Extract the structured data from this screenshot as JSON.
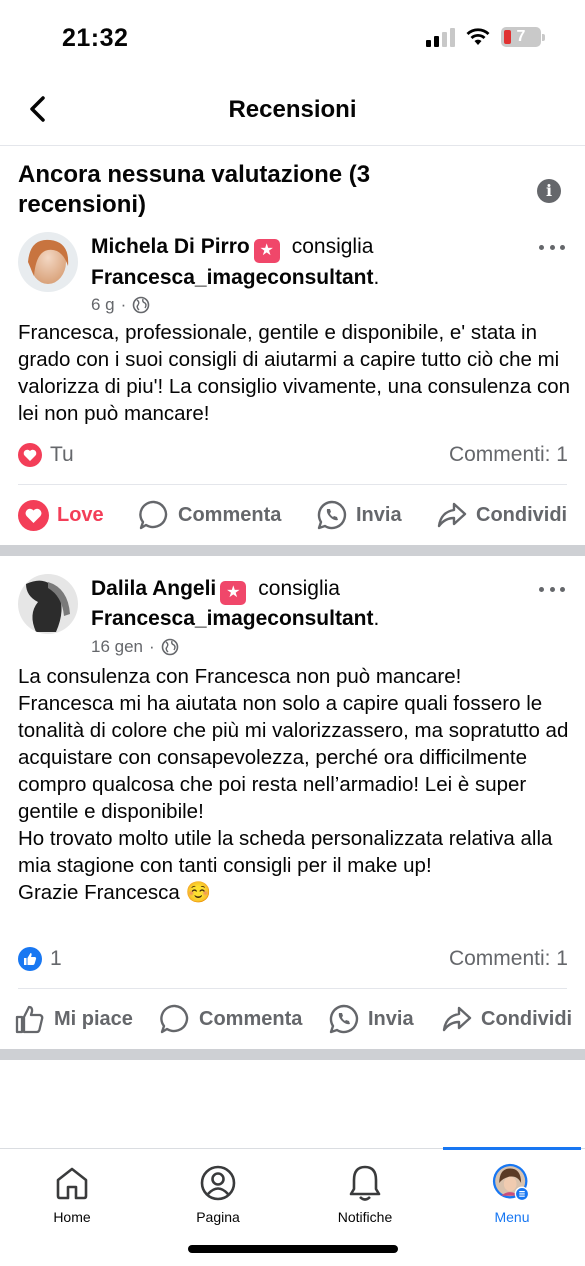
{
  "status_bar": {
    "time": "21:32",
    "battery": "7"
  },
  "header": {
    "title": "Recensioni"
  },
  "summary": {
    "text": "Ancora nessuna valutazione (3 recensioni)"
  },
  "reviews": [
    {
      "author": "Michela Di Pirro",
      "verb": "consiglia",
      "page": "Francesca_imageconsultant",
      "time": "6 g",
      "text": "Francesca, professionale, gentile e disponibile, e' stata in grado con i suoi consigli di aiutarmi a capire tutto ciò che mi valorizza di piu'! La consiglio vivamente, una consulenza con lei non può mancare!",
      "reaction_label": "Tu",
      "comments": "Commenti: 1",
      "actions": {
        "react": "Love",
        "comment": "Commenta",
        "send": "Invia",
        "share": "Condividi"
      }
    },
    {
      "author": "Dalila Angeli",
      "verb": "consiglia",
      "page": "Francesca_imageconsultant",
      "time": "16 gen",
      "text": "La consulenza con Francesca non può mancare!\nFrancesca mi ha aiutata non solo a capire quali fossero le tonalità di colore che più mi valorizzassero, ma sopratutto ad acquistare con consapevolezza, perché ora difficilmente compro qualcosa che poi resta nell’armadio! Lei è super gentile e disponibile!\nHo trovato molto utile la scheda personalizzata relativa alla mia stagione con tanti consigli per il make up!\nGrazie Francesca ☺️",
      "reaction_label": "1",
      "comments": "Commenti: 1",
      "actions": {
        "react": "Mi piace",
        "comment": "Commenta",
        "send": "Invia",
        "share": "Condividi"
      }
    }
  ],
  "bottom_nav": [
    {
      "label": "Home",
      "icon": "home-icon"
    },
    {
      "label": "Pagina",
      "icon": "page-icon"
    },
    {
      "label": "Notifiche",
      "icon": "bell-icon"
    },
    {
      "label": "Menu",
      "icon": "menu-avatar-icon",
      "active": true
    }
  ],
  "colors": {
    "accent": "#1877f2",
    "love": "#f33e58",
    "muted": "#65676b",
    "separator": "#ced0d4"
  }
}
